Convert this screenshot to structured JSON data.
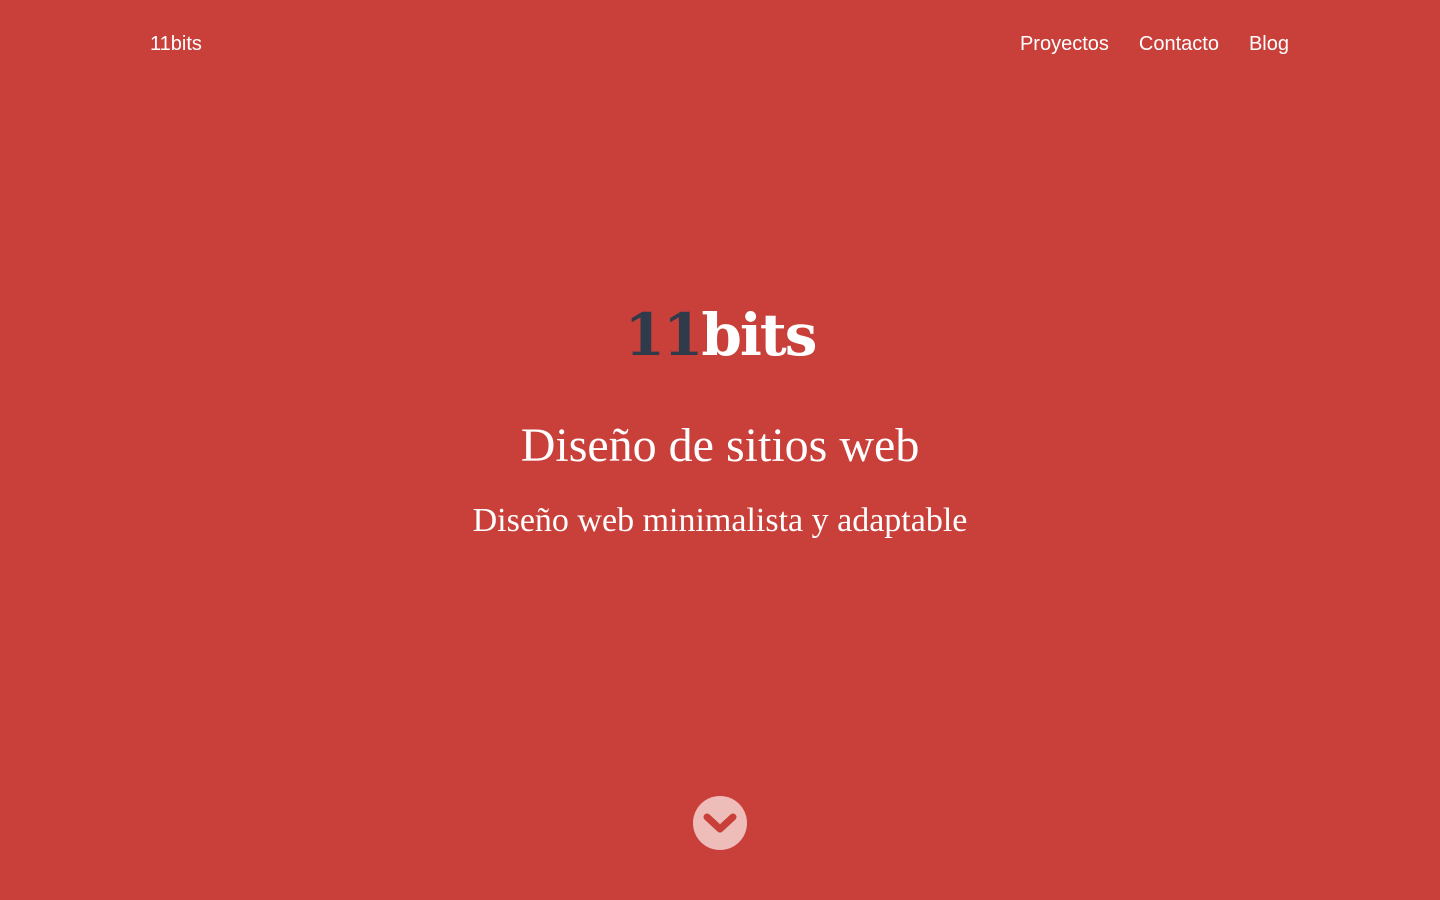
{
  "header": {
    "brand": "11bits",
    "nav": [
      "Proyectos",
      "Contacto",
      "Blog"
    ]
  },
  "hero": {
    "logo_numeric": "11",
    "logo_word": "bits",
    "headline": "Diseño de sitios web",
    "subheadline": "Diseño web minimalista y adaptable"
  },
  "scroll_button": {
    "icon": "chevron-down-icon"
  },
  "colors": {
    "background": "#c9403a",
    "logo_numeric": "#2f3b4a",
    "text": "#ffffff",
    "scroll_button_bg": "#efbdb9"
  }
}
